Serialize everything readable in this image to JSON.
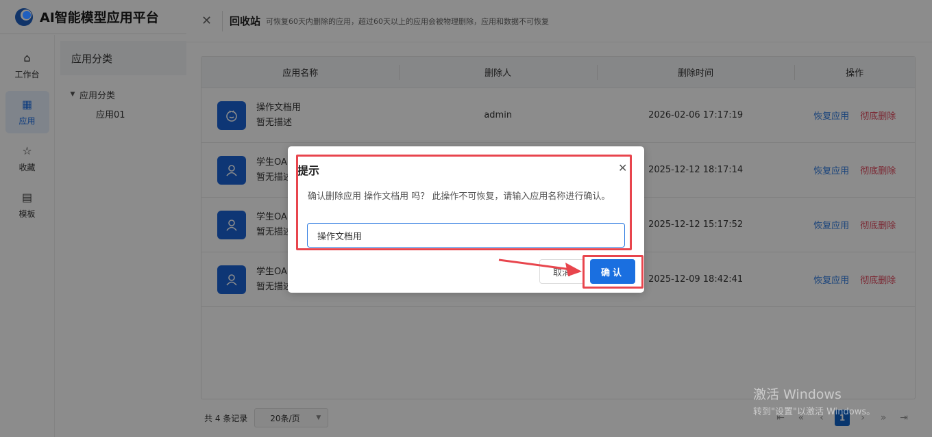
{
  "app": {
    "title": "AI智能模型应用平台"
  },
  "nav": [
    {
      "label": "工作台",
      "icon": "home-icon"
    },
    {
      "label": "应用",
      "icon": "apps-icon",
      "active": true
    },
    {
      "label": "收藏",
      "icon": "star-icon"
    },
    {
      "label": "模板",
      "icon": "template-icon"
    }
  ],
  "category": {
    "header": "应用分类",
    "root": "应用分类",
    "child": "应用01"
  },
  "drawer": {
    "title": "回收站",
    "subtitle": "可恢复60天内删除的应用，超过60天以上的应用会被物理删除，应用和数据不可恢复"
  },
  "table": {
    "columns": [
      "应用名称",
      "删除人",
      "删除时间",
      "操作"
    ],
    "restore_label": "恢复应用",
    "delete_label": "彻底删除",
    "rows": [
      {
        "name": "操作文档用",
        "desc": "暂无描述",
        "deleter": "admin",
        "time": "2026-02-06 17:17:19"
      },
      {
        "name": "学生OA",
        "desc": "暂无描述",
        "deleter": "",
        "time": "2025-12-12 18:17:14"
      },
      {
        "name": "学生OA",
        "desc": "暂无描述",
        "deleter": "",
        "time": "2025-12-12 15:17:52"
      },
      {
        "name": "学生OA",
        "desc": "暂无描述",
        "deleter": "",
        "time": "2025-12-09 18:42:41"
      }
    ]
  },
  "footer": {
    "total": "共 4 条记录",
    "page_size": "20条/页",
    "current_page": "1"
  },
  "dialog": {
    "title": "提示",
    "message": "确认删除应用 操作文档用 吗？ 此操作不可恢复，请输入应用名称进行确认。",
    "input_value": "操作文档用",
    "cancel_label": "取消",
    "ok_label": "确认"
  },
  "watermark": {
    "line1": "激活 Windows",
    "line2": "转到\"设置\"以激活 Windows。"
  },
  "colors": {
    "primary": "#1a6fe0",
    "danger": "#e0455a",
    "highlight": "#e8454d"
  }
}
